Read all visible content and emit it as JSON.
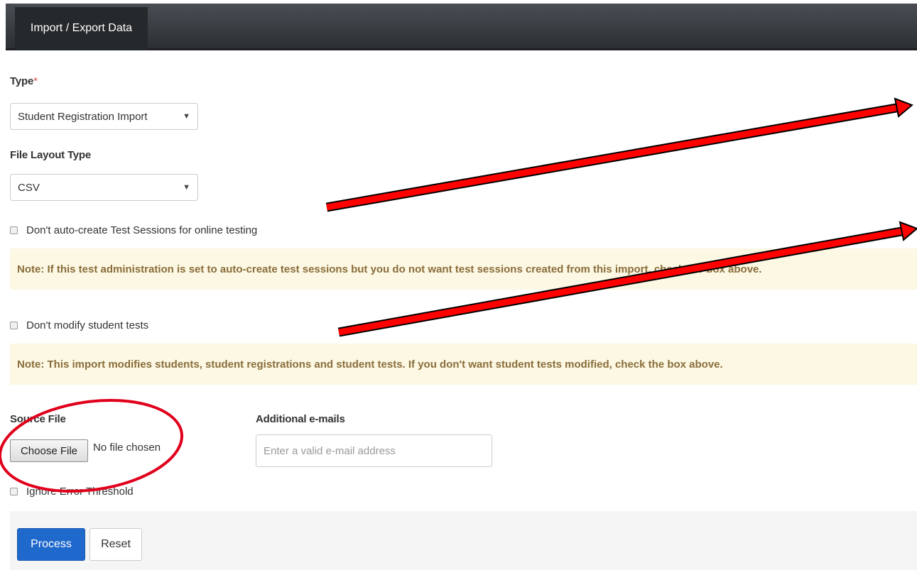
{
  "header": {
    "tab_title": "Import / Export Data"
  },
  "form": {
    "type_label": "Type",
    "required_mark": "*",
    "type_value": "Student Registration Import",
    "layout_label": "File Layout Type",
    "layout_value": "CSV",
    "dont_autocreate_label": "Don't auto-create Test Sessions for online testing",
    "note_autocreate": "Note: If this test administration is set to auto-create test sessions but you do  not want test sessions created from this import, check the box above.",
    "dont_modify_label": "Don't modify student tests",
    "note_modify": "Note: This import modifies students, student registrations and student tests. If you don't want student tests modified, check the box above.",
    "source_file_label": "Source File",
    "choose_file_label": "Choose File",
    "no_file_text": "No file chosen",
    "additional_emails_label": "Additional e-mails",
    "email_placeholder": "Enter a valid e-mail address",
    "ignore_threshold_label": "Ignore Error Threshold"
  },
  "footer": {
    "process_label": "Process",
    "reset_label": "Reset"
  },
  "colors": {
    "arrow": "#ff0000",
    "circle": "#e0001b",
    "primary": "#1f68cc",
    "note_bg": "#fcf8e3"
  }
}
